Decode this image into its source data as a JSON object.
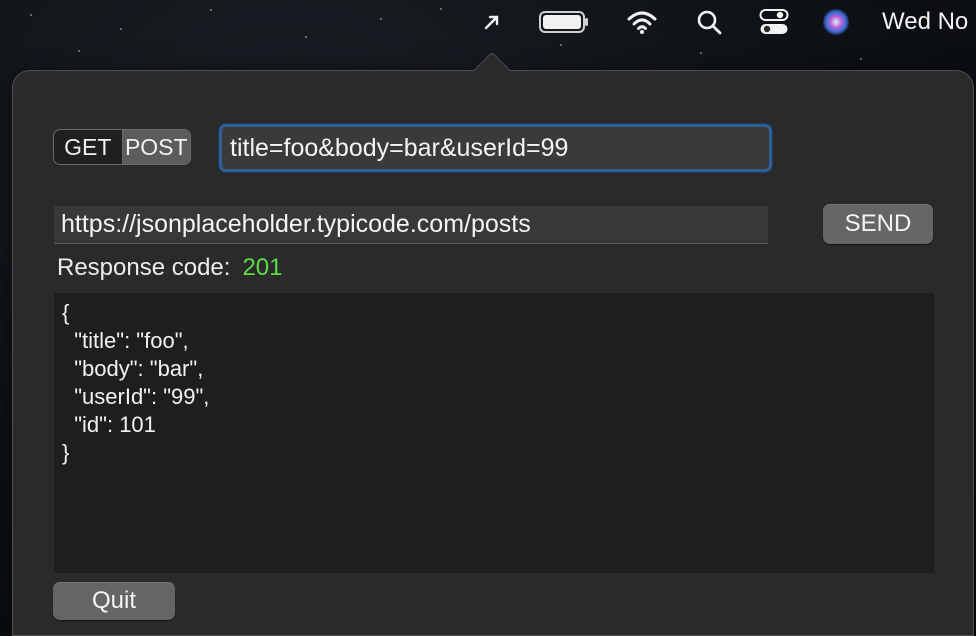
{
  "menubar": {
    "icons": [
      "location-arrow-icon",
      "battery-icon",
      "wifi-icon",
      "search-icon",
      "control-center-icon",
      "siri-icon"
    ],
    "clock": "Wed No"
  },
  "popover": {
    "method_tabs": [
      {
        "label": "GET",
        "selected": false
      },
      {
        "label": "POST",
        "selected": true
      }
    ],
    "params_value": "title=foo&body=bar&userId=99",
    "url_value": "https://jsonplaceholder.typicode.com/posts",
    "send_label": "SEND",
    "response_label": "Response code:",
    "response_code": "201",
    "response_body": "{\n  \"title\": \"foo\",\n  \"body\": \"bar\",\n  \"userId\": \"99\",\n  \"id\": 101\n}",
    "quit_label": "Quit"
  },
  "colors": {
    "success": "#5ddc45",
    "focus_ring": "#2f5f94",
    "panel": "#2a2a2a"
  }
}
